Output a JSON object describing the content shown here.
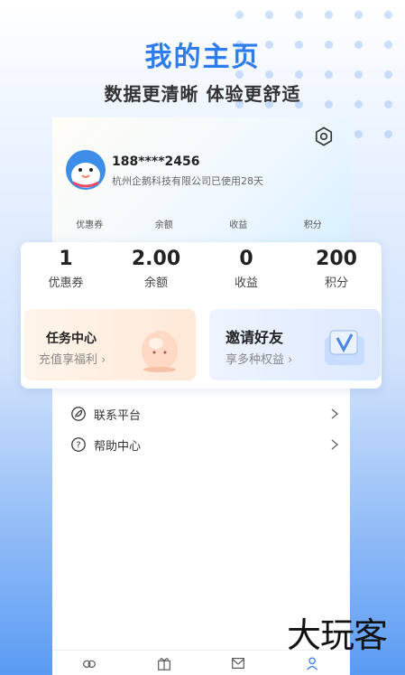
{
  "promo": {
    "title": "我的主页",
    "subtitle": "数据更清晰 体验更舒适"
  },
  "profile": {
    "phone": "188****2456",
    "company_line": "杭州企鹅科技有限公司已使用28天"
  },
  "mini_stats": [
    "优惠券",
    "余额",
    "收益",
    "积分"
  ],
  "stats": [
    {
      "value": "1",
      "label": "优惠券"
    },
    {
      "value": "2.00",
      "label": "余额"
    },
    {
      "value": "0",
      "label": "收益"
    },
    {
      "value": "200",
      "label": "积分"
    }
  ],
  "task_card": {
    "title": "任务中心",
    "subtitle": "充值享福利 ›"
  },
  "invite_card": {
    "title": "邀请好友",
    "subtitle": "享多种权益 ›"
  },
  "menu": [
    {
      "label": "联系平台",
      "icon": "leaf-icon"
    },
    {
      "label": "帮助中心",
      "icon": "question-icon"
    }
  ],
  "tabs": [
    "home-icon",
    "gift-icon",
    "mail-icon",
    "profile-icon"
  ],
  "watermark": "大玩客",
  "colors": {
    "accent": "#2d7cf0",
    "avatar": "#3d8ee9"
  }
}
